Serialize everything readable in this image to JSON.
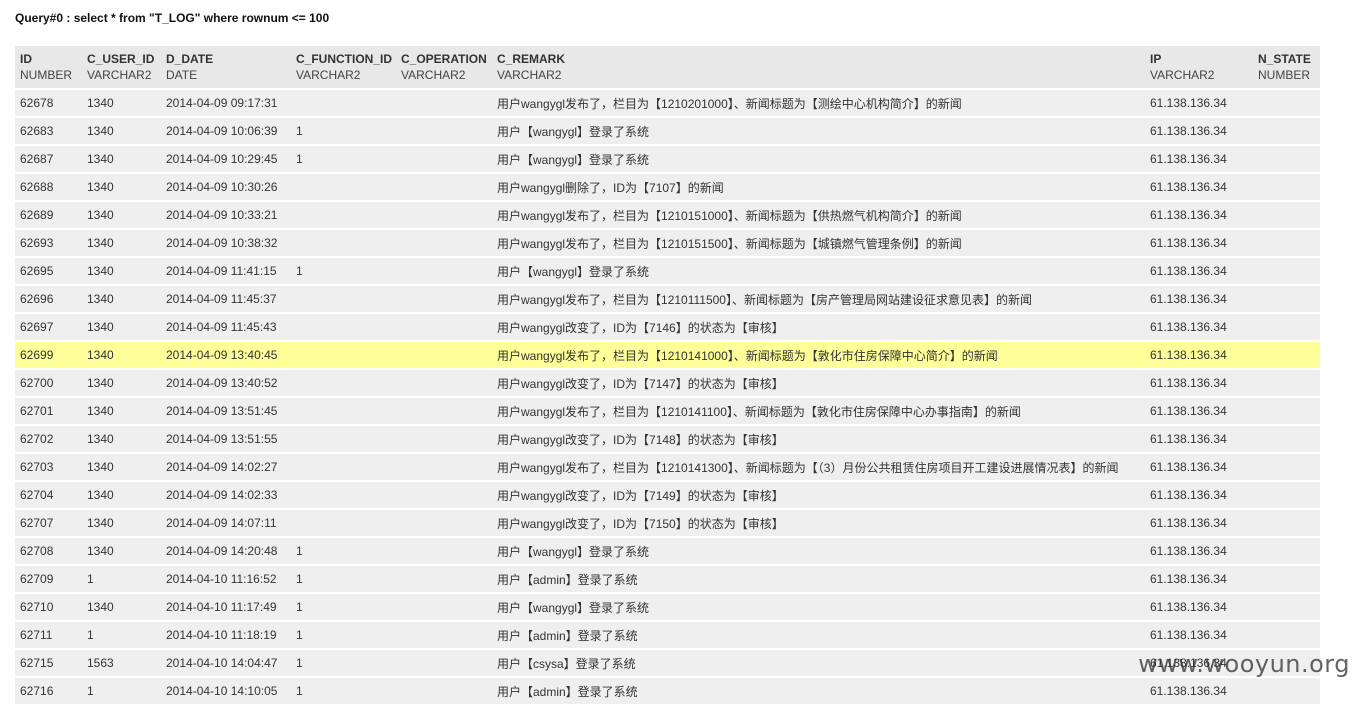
{
  "query": {
    "title": "Query#0 : select * from \"T_LOG\" where rownum <= 100"
  },
  "columns": [
    {
      "name": "ID",
      "type": "NUMBER"
    },
    {
      "name": "C_USER_ID",
      "type": "VARCHAR2"
    },
    {
      "name": "D_DATE",
      "type": "DATE"
    },
    {
      "name": "C_FUNCTION_ID",
      "type": "VARCHAR2"
    },
    {
      "name": "C_OPERATION",
      "type": "VARCHAR2"
    },
    {
      "name": "C_REMARK",
      "type": "VARCHAR2"
    },
    {
      "name": "IP",
      "type": "VARCHAR2"
    },
    {
      "name": "N_STATE",
      "type": "NUMBER"
    }
  ],
  "rows": [
    {
      "id": "62678",
      "user": "1340",
      "date": "2014-04-09 09:17:31",
      "func": "",
      "op": "",
      "remark": "用户wangygl发布了，栏目为【1210201000】、新闻标题为【测绘中心机构简介】的新闻",
      "ip": "61.138.136.34",
      "state": "",
      "highlight": false
    },
    {
      "id": "62683",
      "user": "1340",
      "date": "2014-04-09 10:06:39",
      "func": "1",
      "op": "",
      "remark": "用户【wangygl】登录了系统",
      "ip": "61.138.136.34",
      "state": "",
      "highlight": false
    },
    {
      "id": "62687",
      "user": "1340",
      "date": "2014-04-09 10:29:45",
      "func": "1",
      "op": "",
      "remark": "用户【wangygl】登录了系统",
      "ip": "61.138.136.34",
      "state": "",
      "highlight": false
    },
    {
      "id": "62688",
      "user": "1340",
      "date": "2014-04-09 10:30:26",
      "func": "",
      "op": "",
      "remark": "用户wangygl删除了，ID为【7107】的新闻",
      "ip": "61.138.136.34",
      "state": "",
      "highlight": false
    },
    {
      "id": "62689",
      "user": "1340",
      "date": "2014-04-09 10:33:21",
      "func": "",
      "op": "",
      "remark": "用户wangygl发布了，栏目为【1210151000】、新闻标题为【供热燃气机构简介】的新闻",
      "ip": "61.138.136.34",
      "state": "",
      "highlight": false
    },
    {
      "id": "62693",
      "user": "1340",
      "date": "2014-04-09 10:38:32",
      "func": "",
      "op": "",
      "remark": "用户wangygl发布了，栏目为【1210151500】、新闻标题为【城镇燃气管理条例】的新闻",
      "ip": "61.138.136.34",
      "state": "",
      "highlight": false
    },
    {
      "id": "62695",
      "user": "1340",
      "date": "2014-04-09 11:41:15",
      "func": "1",
      "op": "",
      "remark": "用户【wangygl】登录了系统",
      "ip": "61.138.136.34",
      "state": "",
      "highlight": false
    },
    {
      "id": "62696",
      "user": "1340",
      "date": "2014-04-09 11:45:37",
      "func": "",
      "op": "",
      "remark": "用户wangygl发布了，栏目为【1210111500】、新闻标题为【房产管理局网站建设征求意见表】的新闻",
      "ip": "61.138.136.34",
      "state": "",
      "highlight": false
    },
    {
      "id": "62697",
      "user": "1340",
      "date": "2014-04-09 11:45:43",
      "func": "",
      "op": "",
      "remark": "用户wangygl改变了，ID为【7146】的状态为【审核】",
      "ip": "61.138.136.34",
      "state": "",
      "highlight": false
    },
    {
      "id": "62699",
      "user": "1340",
      "date": "2014-04-09 13:40:45",
      "func": "",
      "op": "",
      "remark": "用户wangygl发布了，栏目为【1210141000】、新闻标题为【敦化市住房保障中心简介】的新闻",
      "ip": "61.138.136.34",
      "state": "",
      "highlight": true
    },
    {
      "id": "62700",
      "user": "1340",
      "date": "2014-04-09 13:40:52",
      "func": "",
      "op": "",
      "remark": "用户wangygl改变了，ID为【7147】的状态为【审核】",
      "ip": "61.138.136.34",
      "state": "",
      "highlight": false
    },
    {
      "id": "62701",
      "user": "1340",
      "date": "2014-04-09 13:51:45",
      "func": "",
      "op": "",
      "remark": "用户wangygl发布了，栏目为【1210141100】、新闻标题为【敦化市住房保障中心办事指南】的新闻",
      "ip": "61.138.136.34",
      "state": "",
      "highlight": false
    },
    {
      "id": "62702",
      "user": "1340",
      "date": "2014-04-09 13:51:55",
      "func": "",
      "op": "",
      "remark": "用户wangygl改变了，ID为【7148】的状态为【审核】",
      "ip": "61.138.136.34",
      "state": "",
      "highlight": false
    },
    {
      "id": "62703",
      "user": "1340",
      "date": "2014-04-09 14:02:27",
      "func": "",
      "op": "",
      "remark": "用户wangygl发布了，栏目为【1210141300】、新闻标题为【（3）月份公共租赁住房项目开工建设进展情况表】的新闻",
      "ip": "61.138.136.34",
      "state": "",
      "highlight": false
    },
    {
      "id": "62704",
      "user": "1340",
      "date": "2014-04-09 14:02:33",
      "func": "",
      "op": "",
      "remark": "用户wangygl改变了，ID为【7149】的状态为【审核】",
      "ip": "61.138.136.34",
      "state": "",
      "highlight": false
    },
    {
      "id": "62707",
      "user": "1340",
      "date": "2014-04-09 14:07:11",
      "func": "",
      "op": "",
      "remark": "用户wangygl改变了，ID为【7150】的状态为【审核】",
      "ip": "61.138.136.34",
      "state": "",
      "highlight": false
    },
    {
      "id": "62708",
      "user": "1340",
      "date": "2014-04-09 14:20:48",
      "func": "1",
      "op": "",
      "remark": "用户【wangygl】登录了系统",
      "ip": "61.138.136.34",
      "state": "",
      "highlight": false
    },
    {
      "id": "62709",
      "user": "1",
      "date": "2014-04-10 11:16:52",
      "func": "1",
      "op": "",
      "remark": "用户【admin】登录了系统",
      "ip": "61.138.136.34",
      "state": "",
      "highlight": false
    },
    {
      "id": "62710",
      "user": "1340",
      "date": "2014-04-10 11:17:49",
      "func": "1",
      "op": "",
      "remark": "用户【wangygl】登录了系统",
      "ip": "61.138.136.34",
      "state": "",
      "highlight": false
    },
    {
      "id": "62711",
      "user": "1",
      "date": "2014-04-10 11:18:19",
      "func": "1",
      "op": "",
      "remark": "用户【admin】登录了系统",
      "ip": "61.138.136.34",
      "state": "",
      "highlight": false
    },
    {
      "id": "62715",
      "user": "1563",
      "date": "2014-04-10 14:04:47",
      "func": "1",
      "op": "",
      "remark": "用户【csysa】登录了系统",
      "ip": "61.138.136.34",
      "state": "",
      "highlight": false
    },
    {
      "id": "62716",
      "user": "1",
      "date": "2014-04-10 14:10:05",
      "func": "1",
      "op": "",
      "remark": "用户【admin】登录了系统",
      "ip": "61.138.136.34",
      "state": "",
      "highlight": false
    }
  ],
  "watermark": "www.wooyun.org"
}
